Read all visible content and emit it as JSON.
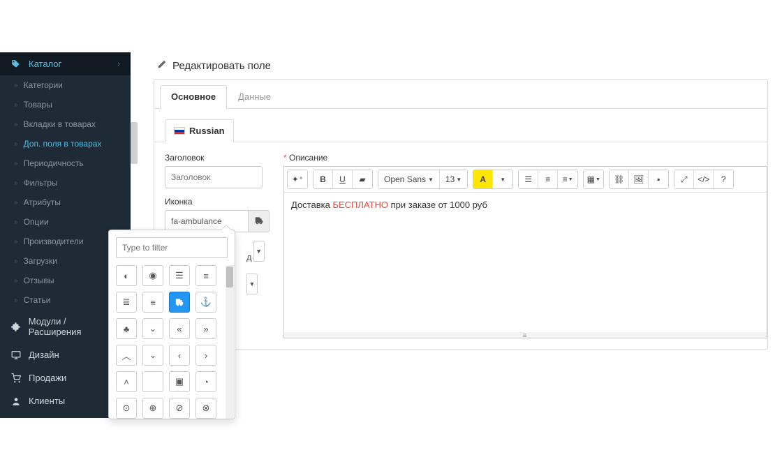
{
  "sidebar": {
    "parent_label": "Каталог",
    "items": [
      {
        "label": "Категории"
      },
      {
        "label": "Товары"
      },
      {
        "label": "Вкладки в товарах"
      },
      {
        "label": "Доп. поля в товарах",
        "active": true
      },
      {
        "label": "Периодичность"
      },
      {
        "label": "Фильтры"
      },
      {
        "label": "Атрибуты"
      },
      {
        "label": "Опции"
      },
      {
        "label": "Производители"
      },
      {
        "label": "Загрузки"
      },
      {
        "label": "Отзывы"
      },
      {
        "label": "Статьи"
      }
    ],
    "sections": [
      {
        "label": "Модули / Расширения",
        "icon": "puzzle"
      },
      {
        "label": "Дизайн",
        "icon": "monitor"
      },
      {
        "label": "Продажи",
        "icon": "cart"
      },
      {
        "label": "Клиенты",
        "icon": "user"
      }
    ]
  },
  "page": {
    "title": "Редактировать поле"
  },
  "tabs": {
    "main": "Основное",
    "data": "Данные"
  },
  "lang": {
    "name": "Russian"
  },
  "form": {
    "title_label": "Заголовок",
    "title_placeholder": "Заголовок",
    "icon_label": "Иконка",
    "icon_value": "fa-ambulance",
    "desc_label": "Описание",
    "desc_text_1": "Доставка ",
    "desc_text_free": "БЕСПЛАТНО",
    "desc_text_2": " при заказе от 1000 руб"
  },
  "editor": {
    "font": "Open Sans",
    "size": "13"
  },
  "picker": {
    "filter_placeholder": "Type to filter"
  },
  "hidden": {
    "d": "д"
  }
}
